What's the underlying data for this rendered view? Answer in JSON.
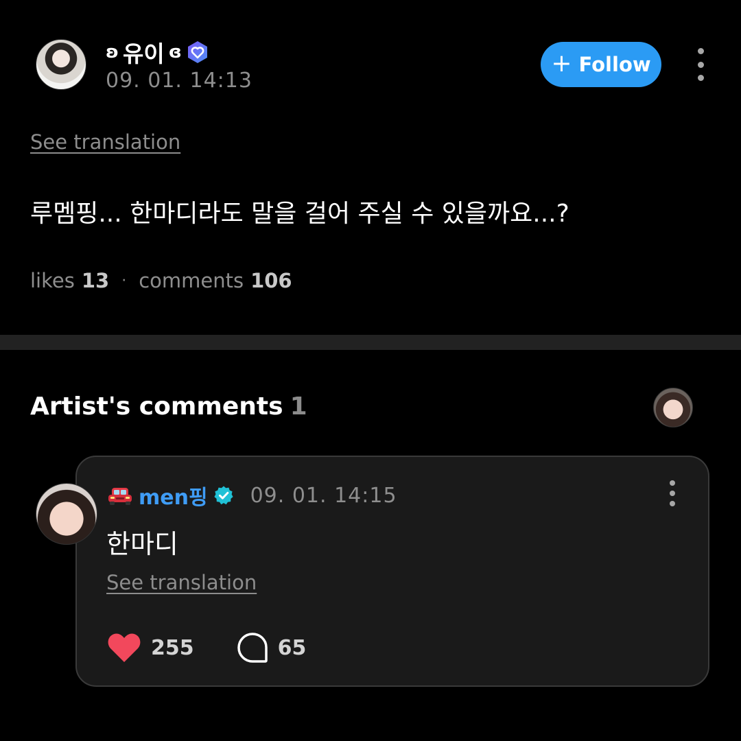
{
  "post": {
    "author": {
      "prefix": "ʚ",
      "name": "유이",
      "suffix": "ɞ"
    },
    "timestamp": "09. 01. 14:13",
    "follow_label": "Follow",
    "see_translation": "See translation",
    "body": "루멤핑... 한마디라도 말을 걸어 주실 수 있을까요...?",
    "stats": {
      "likes_label": "likes",
      "likes_count": "13",
      "separator": "·",
      "comments_label": "comments",
      "comments_count": "106"
    }
  },
  "artist_comments": {
    "title": "Artist's comments",
    "count": "1",
    "comment": {
      "author": "men핑",
      "timestamp": "09. 01. 14:15",
      "text": "한마디",
      "see_translation": "See translation",
      "likes": "255",
      "replies": "65"
    }
  },
  "icons": {
    "verified_post": "verified-heart-badge-icon",
    "verified_comment": "verified-check-badge-icon",
    "author_emoji": "car-icon",
    "like": "heart-icon",
    "reply": "speech-bubble-icon",
    "more": "more-vertical-icon"
  },
  "colors": {
    "background": "#000000",
    "follow_button": "#2b9bf4",
    "commenter_name": "#3f9cf5",
    "heart": "#f2485c",
    "card_background": "#1a1a1a",
    "muted_text": "#8e8e8e"
  }
}
